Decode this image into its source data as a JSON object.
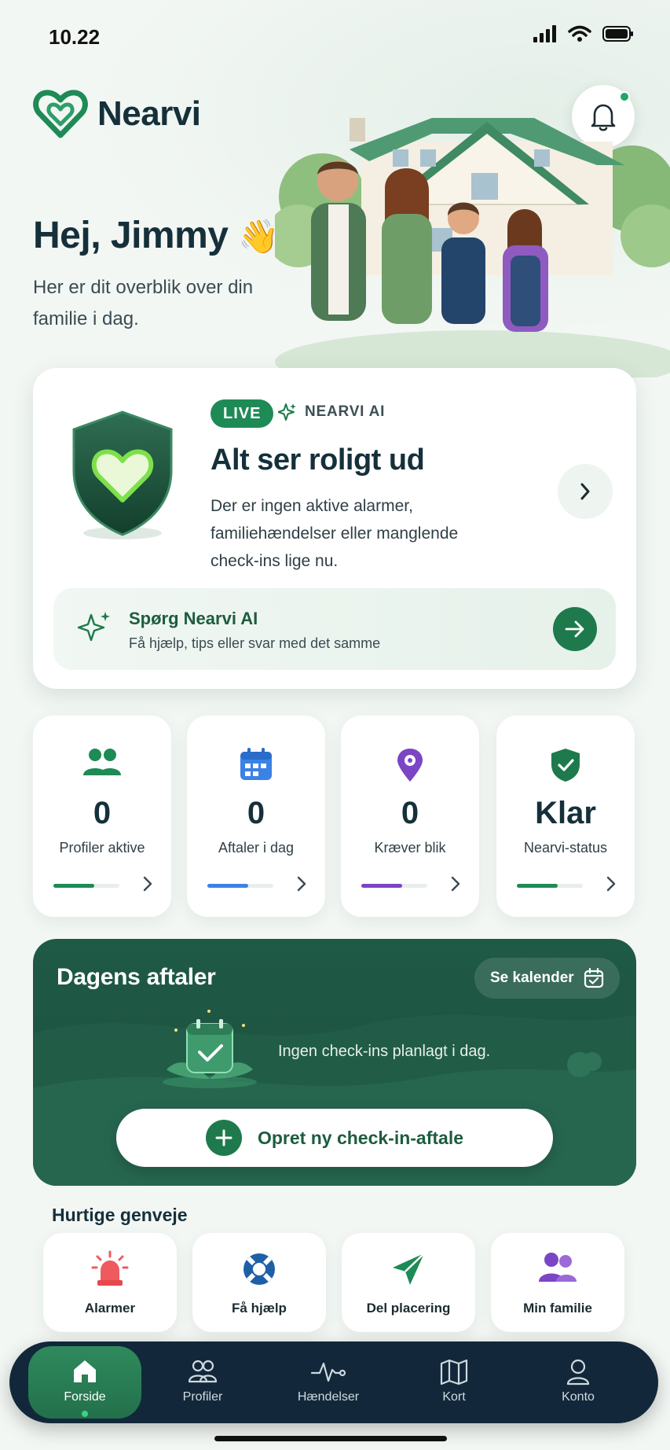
{
  "status_bar": {
    "time": "10.22"
  },
  "header": {
    "app_name": "Nearvi",
    "notification_indicator": true
  },
  "greeting": {
    "title": "Hej, Jimmy",
    "emoji": "👋",
    "subtitle": "Her er dit overblik over din familie i dag."
  },
  "status_card": {
    "live_badge": "LIVE",
    "ai_label": "NEARVI AI",
    "title": "Alt ser roligt ud",
    "description": "Der er ingen aktive alarmer, familiehændelser eller manglende check-ins lige nu.",
    "ask_ai": {
      "title": "Spørg Nearvi AI",
      "subtitle": "Få hjælp, tips eller svar med det samme"
    }
  },
  "stats": [
    {
      "value": "0",
      "label": "Profiler aktive",
      "icon": "people-icon",
      "color": "#1e8a55",
      "progress": 0.62
    },
    {
      "value": "0",
      "label": "Aftaler i dag",
      "icon": "calendar-icon",
      "color": "#3b82e6",
      "progress": 0.62
    },
    {
      "value": "0",
      "label": "Kræver blik",
      "icon": "location-pin-icon",
      "color": "#7b45c4",
      "progress": 0.62
    },
    {
      "value": "Klar",
      "label": "Nearvi-status",
      "icon": "shield-check-icon",
      "color": "#1e8a55",
      "progress": 0.62
    }
  ],
  "appointments": {
    "title": "Dagens aftaler",
    "calendar_button": "Se kalender",
    "empty_text": "Ingen check-ins planlagt i dag.",
    "create_button": "Opret ny check-in-aftale"
  },
  "shortcuts": {
    "title": "Hurtige genveje",
    "items": [
      {
        "label": "Alarmer",
        "icon": "siren-icon",
        "color": "#e5484d"
      },
      {
        "label": "Få hjælp",
        "icon": "lifebuoy-icon",
        "color": "#1f5fa8"
      },
      {
        "label": "Del placering",
        "icon": "send-icon",
        "color": "#1e8a55"
      },
      {
        "label": "Min familie",
        "icon": "family-icon",
        "color": "#7b45c4"
      }
    ]
  },
  "nav": {
    "items": [
      {
        "label": "Forside",
        "icon": "home-icon",
        "active": true
      },
      {
        "label": "Profiler",
        "icon": "profiles-icon",
        "active": false
      },
      {
        "label": "Hændelser",
        "icon": "activity-icon",
        "active": false
      },
      {
        "label": "Kort",
        "icon": "map-icon",
        "active": false
      },
      {
        "label": "Konto",
        "icon": "account-icon",
        "active": false
      }
    ]
  },
  "colors": {
    "brand": "#1e8a55",
    "dark_green": "#1f5a46",
    "nav_bg": "#12283a"
  }
}
